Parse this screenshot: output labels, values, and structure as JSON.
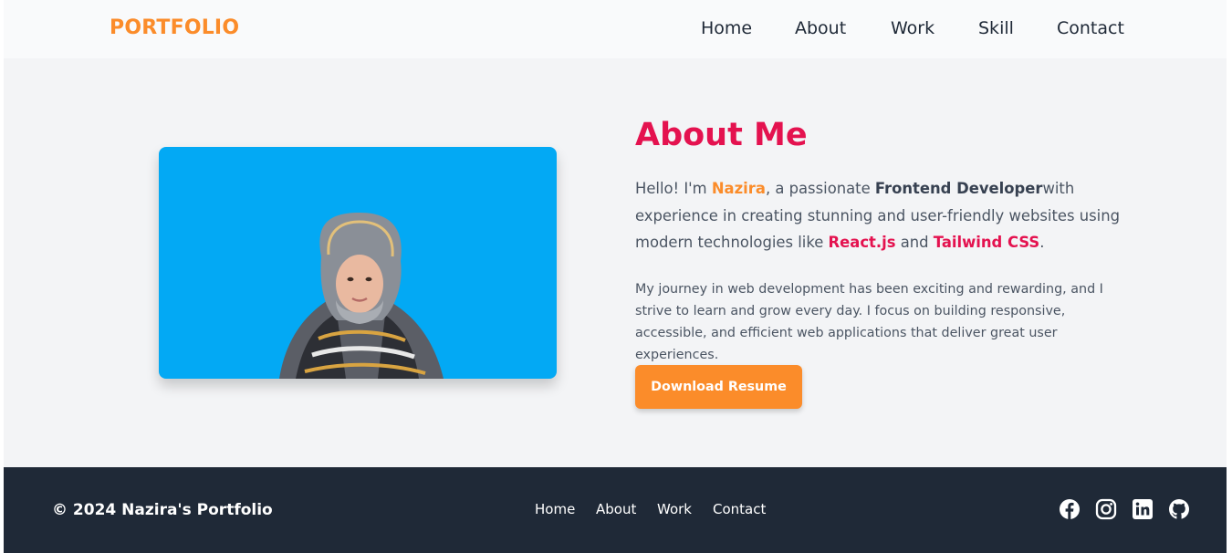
{
  "header": {
    "brand": "PORTFOLIO",
    "nav": [
      "Home",
      "About",
      "Work",
      "Skill",
      "Contact"
    ]
  },
  "about": {
    "title": "About Me",
    "intro": {
      "part1": "Hello! I'm ",
      "name": "Nazira",
      "part2": ", a passionate ",
      "role": "Frontend Developer",
      "part3": "with experience in creating stunning and user-friendly websites using modern technologies like ",
      "tech1": "React.js",
      "part4": " and ",
      "tech2": "Tailwind CSS",
      "part5": "."
    },
    "journey": "My journey in web development has been exciting and rewarding, and I strive to learn and grow every day. I focus on building responsive, accessible, and efficient web applications that deliver great user experiences.",
    "button": "Download Resume"
  },
  "footer": {
    "copyright": "© 2024 Nazira's Portfolio",
    "nav": [
      "Home",
      "About",
      "Work",
      "Contact"
    ],
    "social_icons": [
      "facebook-icon",
      "instagram-icon",
      "linkedin-icon",
      "github-icon"
    ]
  },
  "colors": {
    "accent_orange": "#fb8c2a",
    "accent_pink": "#e4124f",
    "photo_bg": "#03a9f4",
    "footer_bg": "#1f2937"
  }
}
